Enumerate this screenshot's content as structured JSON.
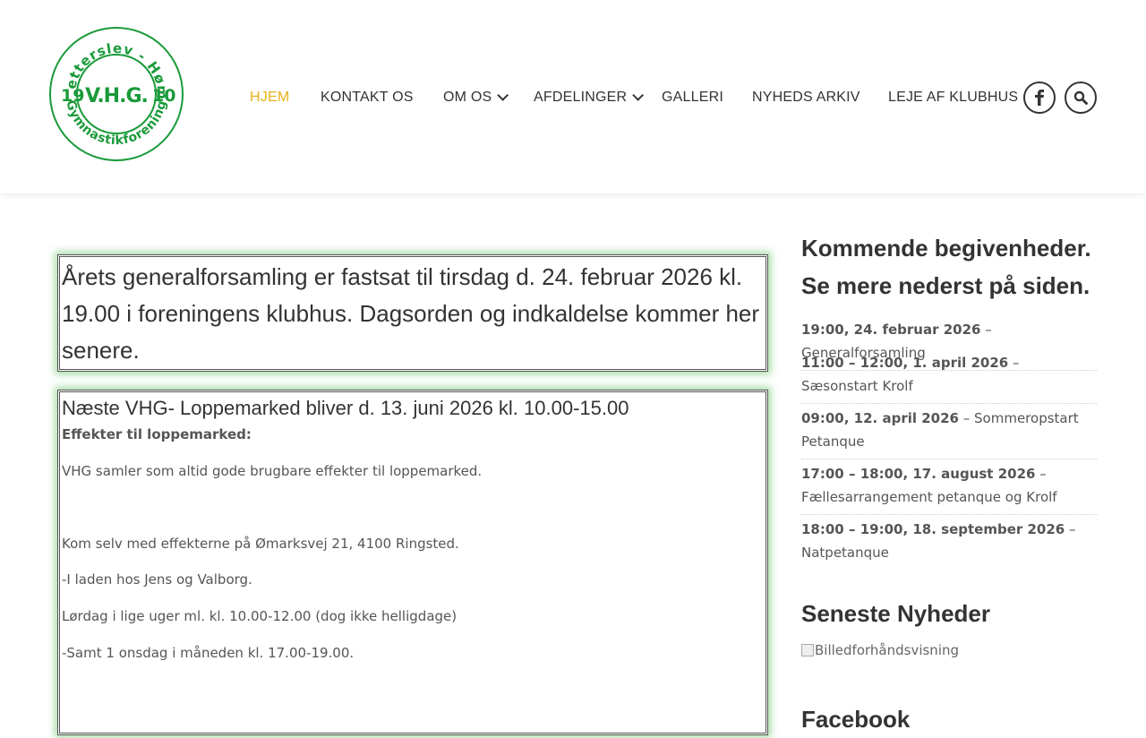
{
  "header": {
    "logo": {
      "top_text": "Vetterslev - Høm",
      "bottom_text": "Gymnastikforening",
      "year_left": "19",
      "year_right": "10",
      "initials": "V.H.G.",
      "color": "#1a9a3a"
    },
    "nav": [
      {
        "label": "HJEM",
        "active": true
      },
      {
        "label": "KONTAKT OS"
      },
      {
        "label": "OM OS",
        "has_dropdown": true
      },
      {
        "label": "AFDELINGER",
        "has_dropdown": true
      },
      {
        "label": "GALLERI"
      },
      {
        "label": "NYHEDS ARKIV"
      },
      {
        "label": "LEJE AF KLUBHUS"
      }
    ],
    "facebook_icon": "facebook-icon",
    "search_icon": "search-icon",
    "accent_color": "#e8b21a"
  },
  "main": {
    "announcement": "Årets generalforsamling er fastsat til tirsdag d. 24. februar 2026 kl. 19.00 i foreningens klubhus. Dagsorden og indkaldelse kommer her senere.",
    "flea_market": {
      "heading": "Næste VHG- Loppemarked bliver d. 13. juni 2026 kl. 10.00-15.00",
      "subheading": "Effekter til loppemarked:",
      "paragraphs": [
        "VHG samler som altid gode brugbare effekter til loppemarked.",
        "Kom selv med effekterne på Ømarksvej 21, 4100 Ringsted.",
        "-I laden hos Jens og Valborg.",
        "Lørdag i lige uger ml. kl. 10.00-12.00 (dog ikke helligdage)",
        "-Samt 1 onsdag i måneden kl. 17.00-19.00."
      ]
    },
    "box_glow_color": "#3cb43c"
  },
  "sidebar": {
    "events_title": "Kommende begivenheder. Se mere nederst på siden.",
    "events": [
      {
        "time": "19:00, 24. februar 2026",
        "name": "Generalforsamling"
      },
      {
        "time": "11:00 – 12:00, 1. april 2026",
        "name": "Sæsonstart Krolf"
      },
      {
        "time": "09:00, 12. april 2026",
        "name": "Sommeropstart Petanque"
      },
      {
        "time": "17:00 – 18:00, 17. august 2026",
        "name": "Fællesarrangement petanque og Krolf"
      },
      {
        "time": "18:00 – 19:00, 18. september 2026",
        "name": "Natpetanque"
      }
    ],
    "news_title": "Seneste Nyheder",
    "news_image_alt": "Billedforhåndsvisning",
    "cut_heading": "Facebook"
  }
}
